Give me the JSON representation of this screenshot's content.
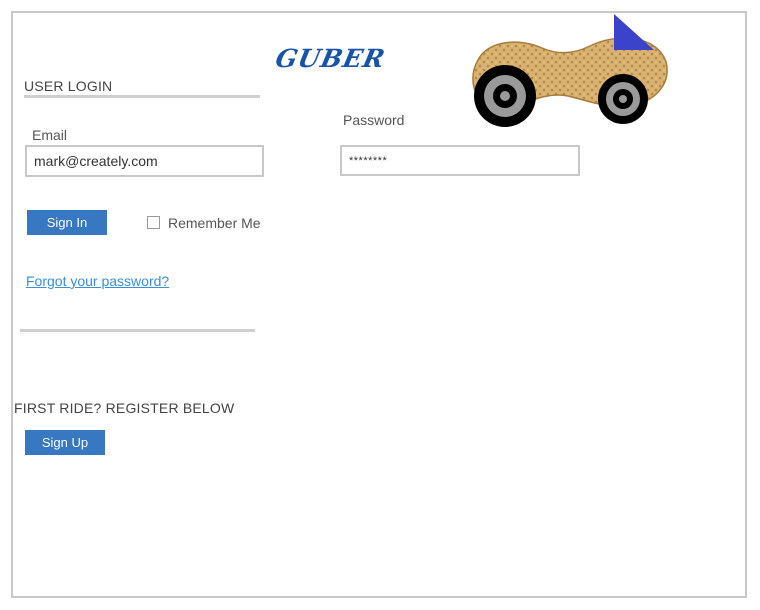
{
  "brand": {
    "name": "GUBER"
  },
  "login": {
    "section_title": "USER LOGIN",
    "email_label": "Email",
    "email_value": "mark@creately.com",
    "password_label": "Password",
    "password_value": "********",
    "sign_in_label": "Sign In",
    "remember_label": "Remember Me",
    "remember_checked": false,
    "forgot_link": "Forgot your password?"
  },
  "register": {
    "section_title": "FIRST RIDE? REGISTER BELOW",
    "sign_up_label": "Sign Up"
  },
  "colors": {
    "accent": "#3877c2",
    "brand": "#1753a8",
    "link": "#3a8fd6",
    "border": "#c8c8c8"
  },
  "icons": {
    "mascot": "peanut-car-icon"
  }
}
